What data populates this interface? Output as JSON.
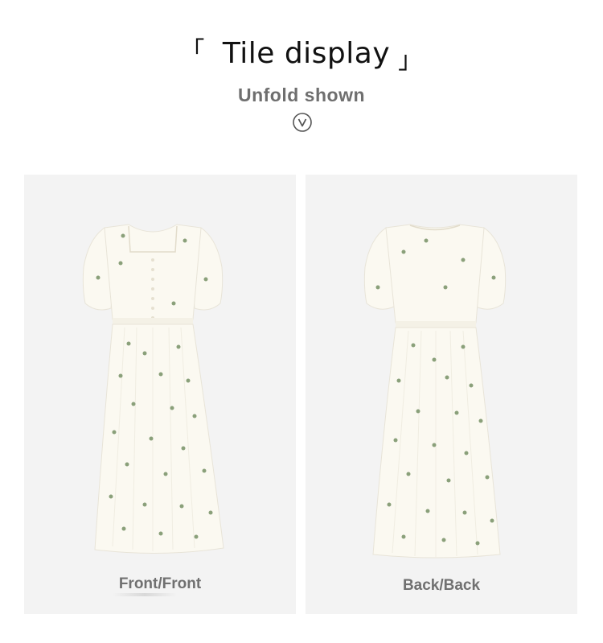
{
  "header": {
    "bracket_left": "「",
    "title": "Tile display",
    "bracket_right": "」",
    "subtitle": "Unfold shown",
    "icon": "chevron-down-circle-icon"
  },
  "panels": [
    {
      "caption": "Front/Front",
      "image": "white-floral-dress-front"
    },
    {
      "caption": "Back/Back",
      "image": "white-floral-dress-back"
    }
  ],
  "colors": {
    "panel_background": "#f3f3f3",
    "dress": "#fbf9f1",
    "floral": "#8aa07a",
    "caption": "#707070",
    "subtitle": "#6f6f6f"
  }
}
